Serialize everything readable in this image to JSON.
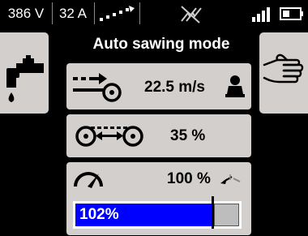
{
  "status": {
    "voltage": "386 V",
    "current": "32 A",
    "icons": [
      "cable-link-icon",
      "no-wireless-icon",
      "signal-strength-icon",
      "battery-icon"
    ]
  },
  "title": "Auto sawing mode",
  "left_button_icon": "water-tap-icon",
  "right_button_icon": "hand-icon",
  "rows": {
    "feed": {
      "icon": "feed-speed-icon",
      "value": "22.5 m/s",
      "status_icon": "operator-icon"
    },
    "traverse": {
      "icon": "traverse-icon",
      "value": "35 %"
    },
    "power": {
      "icon": "power-gauge-icon",
      "value": "100 %",
      "status_icon": "trend-icon"
    }
  },
  "load_bar": {
    "label": "102%",
    "fill_fraction": 0.83,
    "color": "#0000ff"
  },
  "colors": {
    "panel": "#d2cfcc",
    "background": "#000000",
    "accent": "#0000ff"
  }
}
